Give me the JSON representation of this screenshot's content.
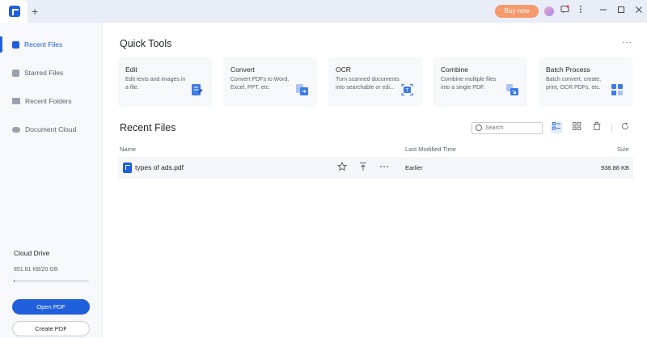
{
  "titlebar": {
    "new_tab_glyph": "+",
    "buy_now_label": "Buy now",
    "icons": [
      "app-logo-icon",
      "avatar-icon",
      "message-icon",
      "more-vertical-icon",
      "minimize-icon",
      "maximize-icon",
      "close-icon"
    ]
  },
  "sidebar": {
    "items": [
      {
        "label": "Recent Files",
        "icon": "document-icon",
        "active": true
      },
      {
        "label": "Starred Files",
        "icon": "star-icon",
        "active": false
      },
      {
        "label": "Recent Folders",
        "icon": "folder-icon",
        "active": false
      },
      {
        "label": "Document Cloud",
        "icon": "cloud-icon",
        "active": false
      }
    ],
    "cloud": {
      "title": "Cloud Drive",
      "usage": "851.81 KB/20 GB",
      "used_fraction": 4e-05
    },
    "open_pdf_label": "Open PDF",
    "create_pdf_label": "Create PDF"
  },
  "main": {
    "quick_tools_title": "Quick Tools",
    "more_glyph": "···",
    "tools": [
      {
        "title": "Edit",
        "desc": "Edit texts and images in a file.",
        "icon": "edit-icon"
      },
      {
        "title": "Convert",
        "desc": "Convert PDFs to Word, Excel, PPT, etc.",
        "icon": "convert-icon"
      },
      {
        "title": "OCR",
        "desc": "Turn scanned documents into searchable or edi...",
        "icon": "ocr-icon"
      },
      {
        "title": "Combine",
        "desc": "Combine multiple files into a single PDF.",
        "icon": "combine-icon"
      },
      {
        "title": "Batch Process",
        "desc": "Batch convert, create, print, OCR PDFs, etc.",
        "icon": "batch-icon"
      }
    ],
    "recent_title": "Recent Files",
    "search_placeholder": "Search",
    "columns": {
      "name": "Name",
      "modified": "Last Modified Time",
      "size": "Size"
    },
    "files": [
      {
        "name": "types of ads.pdf",
        "modified": "Earlier",
        "size": "938.88 KB"
      }
    ]
  },
  "colors": {
    "accent": "#1f5fdc",
    "buy_button": "#f59a6d",
    "sidebar_bg": "#f7f8fa",
    "titlebar_bg": "#e8edf8"
  }
}
